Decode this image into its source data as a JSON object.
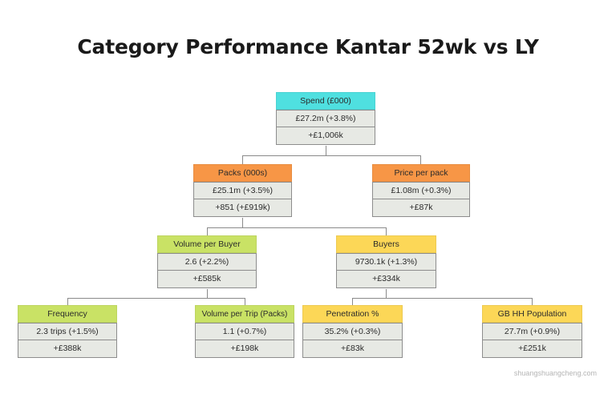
{
  "title": "Category Performance Kantar 52wk vs LY",
  "footer": "shuangshuangcheng.com",
  "colors": {
    "spend": "#4FE0E0",
    "packs": "#F79646",
    "volume_buyer": "#C9E265",
    "buyers": "#FCD757",
    "cell_bg": "#E7E9E4",
    "border": "#8D8D8D",
    "connector": "#8A8A8A"
  },
  "chart_data": {
    "type": "diagram",
    "title": "Category Performance Kantar 52wk vs LY",
    "layout": "tree",
    "nodes": [
      {
        "id": "spend",
        "label": "Spend (£000)",
        "value": "£27.2m (+3.8%)",
        "contribution": "+£1,006k",
        "color": "#4FE0E0",
        "level": 1,
        "children": [
          "packs",
          "price_per_pack"
        ]
      },
      {
        "id": "packs",
        "label": "Packs (000s)",
        "value": "£25.1m (+3.5%)",
        "contribution": "+851 (+£919k)",
        "color": "#F79646",
        "level": 2,
        "children": [
          "volume_per_buyer",
          "buyers"
        ]
      },
      {
        "id": "price_per_pack",
        "label": "Price per pack",
        "value": "£1.08m (+0.3%)",
        "contribution": "+£87k",
        "color": "#F79646",
        "level": 2,
        "children": []
      },
      {
        "id": "volume_per_buyer",
        "label": "Volume per Buyer",
        "value": "2.6 (+2.2%)",
        "contribution": "+£585k",
        "color": "#C9E265",
        "level": 3,
        "children": [
          "frequency",
          "volume_per_trip"
        ]
      },
      {
        "id": "buyers",
        "label": "Buyers",
        "value": "9730.1k (+1.3%)",
        "contribution": "+£334k",
        "color": "#FCD757",
        "level": 3,
        "children": [
          "penetration",
          "gb_hh_population"
        ]
      },
      {
        "id": "frequency",
        "label": "Frequency",
        "value": "2.3 trips (+1.5%)",
        "contribution": "+£388k",
        "color": "#C9E265",
        "level": 4,
        "children": []
      },
      {
        "id": "volume_per_trip",
        "label": "Volume per Trip (Packs)",
        "value": "1.1 (+0.7%)",
        "contribution": "+£198k",
        "color": "#C9E265",
        "level": 4,
        "children": []
      },
      {
        "id": "penetration",
        "label": "Penetration %",
        "value": "35.2% (+0.3%)",
        "contribution": "+£83k",
        "color": "#FCD757",
        "level": 4,
        "children": []
      },
      {
        "id": "gb_hh_population",
        "label": "GB HH Population",
        "value": "27.7m (+0.9%)",
        "contribution": "+£251k",
        "color": "#FCD757",
        "level": 4,
        "children": []
      }
    ]
  }
}
